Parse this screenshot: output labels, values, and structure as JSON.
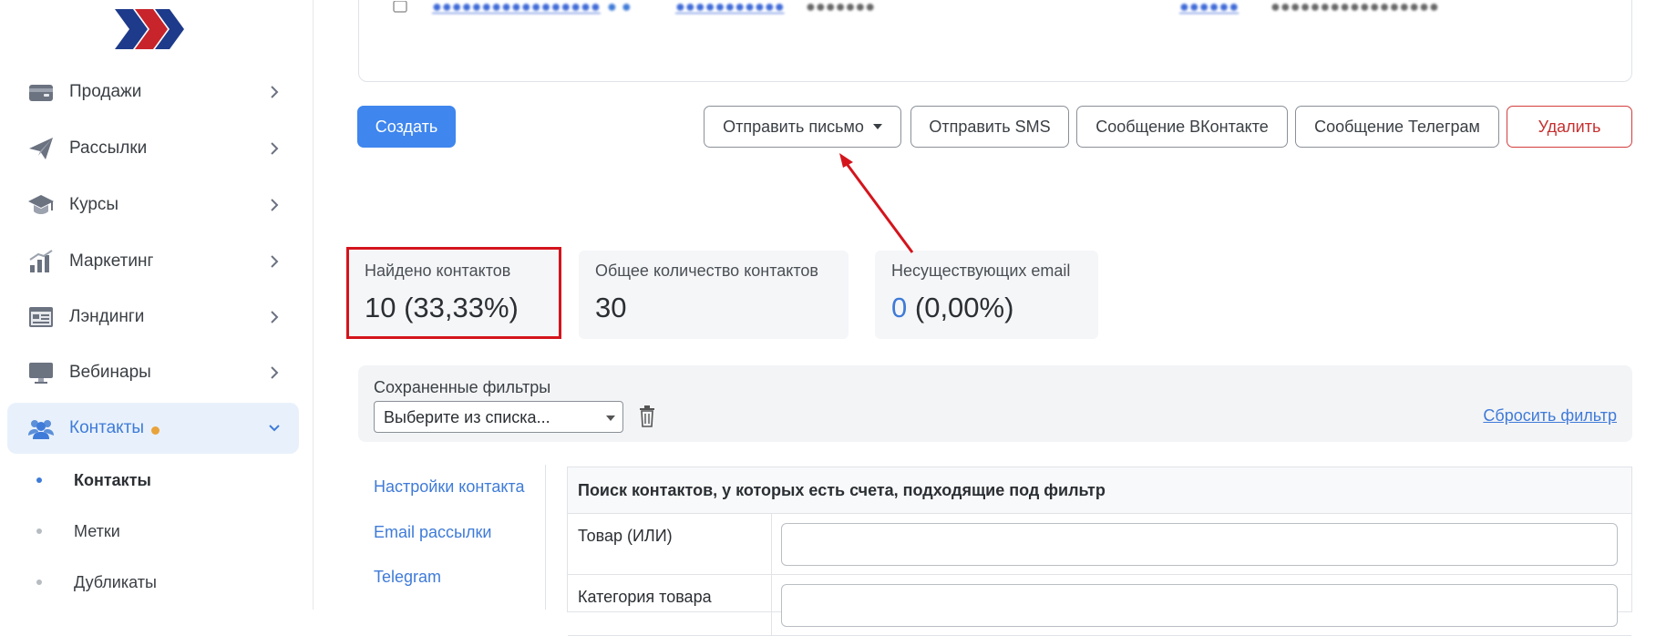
{
  "sidebar": {
    "items": [
      {
        "label": "Продажи",
        "icon": "wallet-icon"
      },
      {
        "label": "Рассылки",
        "icon": "paper-plane-icon"
      },
      {
        "label": "Курсы",
        "icon": "graduation-cap-icon"
      },
      {
        "label": "Маркетинг",
        "icon": "bar-chart-icon"
      },
      {
        "label": "Лэндинги",
        "icon": "landing-page-icon"
      },
      {
        "label": "Вебинары",
        "icon": "monitor-icon"
      },
      {
        "label": "Контакты",
        "icon": "users-icon"
      }
    ],
    "subitems": [
      {
        "label": "Контакты"
      },
      {
        "label": "Метки"
      },
      {
        "label": "Дубликаты"
      }
    ]
  },
  "toolbar": {
    "create": "Создать",
    "send_email": "Отправить письмо",
    "send_sms": "Отправить SMS",
    "vk_message": "Сообщение ВКонтакте",
    "telegram_message": "Сообщение Телеграм",
    "delete": "Удалить"
  },
  "stats": {
    "found_label": "Найдено контактов",
    "found_value": "10 (33,33%)",
    "total_label": "Общее количество контактов",
    "total_value": "30",
    "invalid_label": "Несуществующих email",
    "invalid_count": "0",
    "invalid_pct": "(0,00%)"
  },
  "filters": {
    "saved_label": "Сохраненные фильтры",
    "select_value": "Выберите из списка...",
    "reset_link": "Сбросить фильтр"
  },
  "side_links": [
    "Настройки контакта",
    "Email рассылки",
    "Telegram"
  ],
  "search": {
    "header": "Поиск контактов, у которых есть счета, подходящие под фильтр",
    "rows": [
      {
        "label": "Товар (ИЛИ)"
      },
      {
        "label": "Категория товара"
      }
    ]
  },
  "colors": {
    "primary": "#3f86ee",
    "link": "#3f7bd8",
    "danger": "#c62f2f",
    "highlight": "#d4141c",
    "active_bg": "#e8f1fb"
  }
}
